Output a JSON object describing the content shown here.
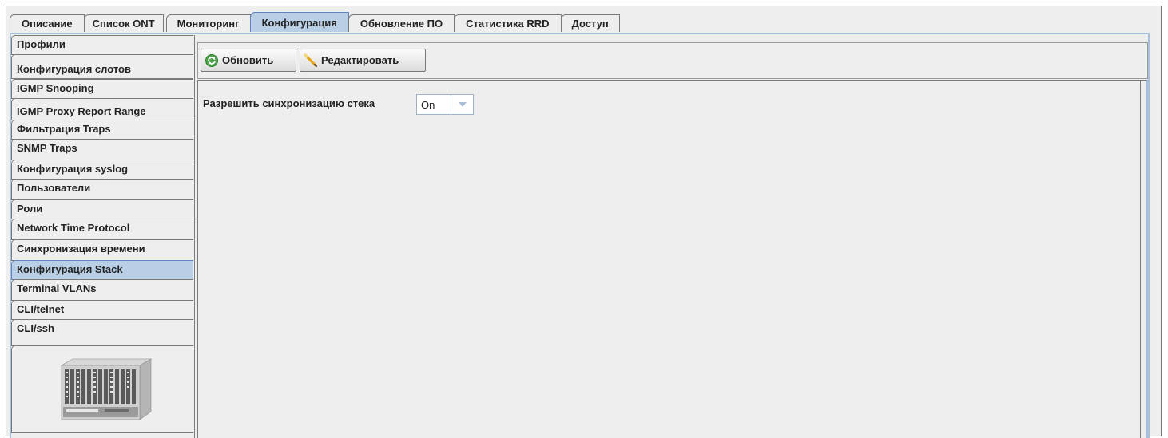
{
  "tabs": [
    {
      "label": "Описание",
      "active": false
    },
    {
      "label": "Список ONT",
      "active": false
    },
    {
      "label": "Мониторинг",
      "active": false
    },
    {
      "label": "Конфигурация",
      "active": true
    },
    {
      "label": "Обновление ПО",
      "active": false
    },
    {
      "label": "Статистика RRD",
      "active": false
    },
    {
      "label": "Доступ",
      "active": false
    }
  ],
  "sidebar": {
    "items": [
      {
        "label": "Профили"
      },
      {
        "label": "Конфигурация слотов"
      },
      {
        "label": "IGMP Snooping"
      },
      {
        "label": "IGMP Proxy Report Range"
      },
      {
        "label": "Фильтрация Traps"
      },
      {
        "label": "SNMP Traps"
      },
      {
        "label": "Конфигурация syslog"
      },
      {
        "label": "Пользователи"
      },
      {
        "label": "Роли"
      },
      {
        "label": "Network Time Protocol"
      },
      {
        "label": "Синхронизация времени"
      },
      {
        "label": "Конфигурация Stack"
      },
      {
        "label": "Terminal VLANs"
      },
      {
        "label": "CLI/telnet"
      },
      {
        "label": "CLI/ssh"
      }
    ],
    "active_item": "Конфигурация Stack",
    "device_image": "olt-chassis-image"
  },
  "toolbar": {
    "refresh_label": "Обновить",
    "refresh_icon": "refresh-icon",
    "edit_label": "Редактировать",
    "edit_icon": "pencil-icon"
  },
  "form": {
    "stack_sync_label": "Разрешить синхронизацию стека",
    "stack_sync_value": "On"
  },
  "colors": {
    "active_tab": "#b8cfe5",
    "panel_bg": "#eeeeee",
    "border_blue": "#a9c0da"
  }
}
